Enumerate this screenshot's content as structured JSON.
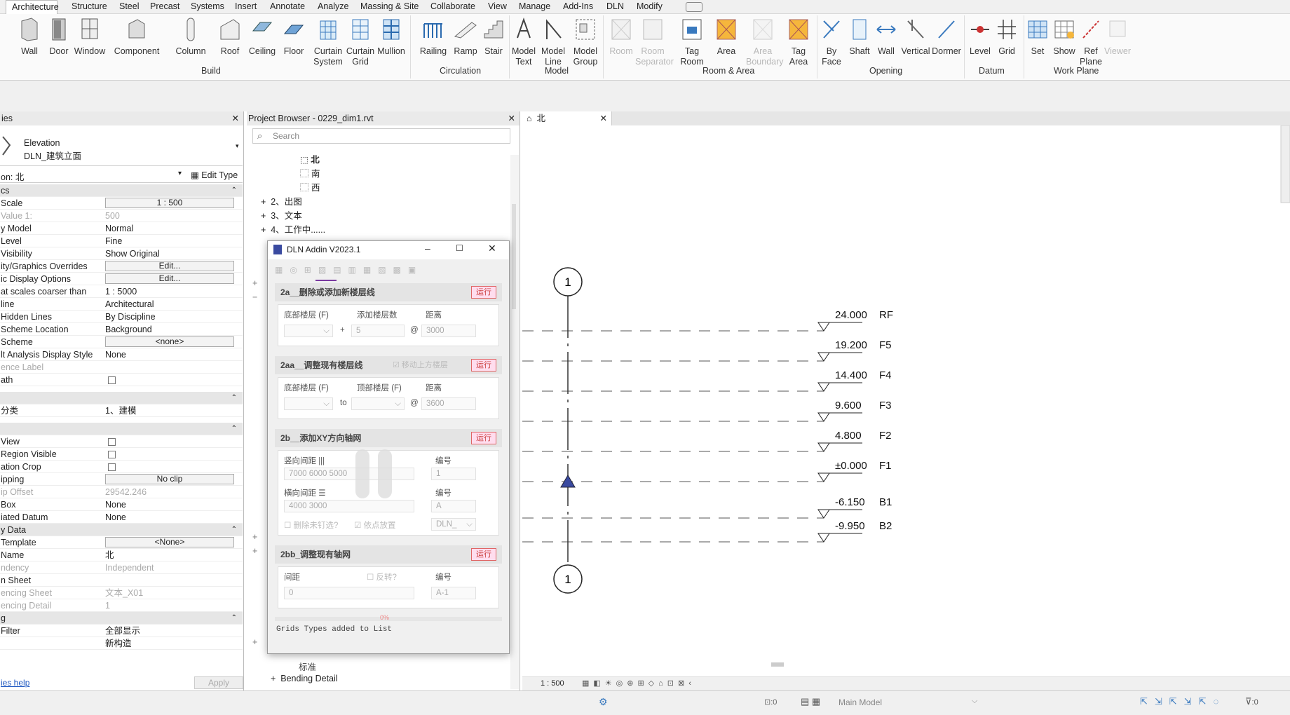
{
  "tabs": [
    "Architecture",
    "Structure",
    "Steel",
    "Precast",
    "Systems",
    "Insert",
    "Annotate",
    "Analyze",
    "Massing & Site",
    "Collaborate",
    "View",
    "Manage",
    "Add-Ins",
    "DLN",
    "Modify"
  ],
  "ribbon": {
    "build": {
      "label": "Build",
      "buttons": [
        "Wall",
        "Door",
        "Window",
        "Component",
        "Column",
        "Roof",
        "Ceiling",
        "Floor",
        "Curtain\nSystem",
        "Curtain\nGrid",
        "Mullion"
      ]
    },
    "circulation": {
      "label": "Circulation",
      "buttons": [
        "Railing",
        "Ramp",
        "Stair"
      ]
    },
    "model": {
      "label": "Model",
      "buttons": [
        "Model\nText",
        "Model\nLine",
        "Model\nGroup"
      ]
    },
    "room_area": {
      "label": "Room & Area",
      "buttons": [
        "Room",
        "Room\nSeparator",
        "Tag\nRoom",
        "Area",
        "Area\nBoundary",
        "Tag\nArea"
      ]
    },
    "opening": {
      "label": "Opening",
      "buttons": [
        "By\nFace",
        "Shaft",
        "Wall",
        "Vertical",
        "Dormer"
      ]
    },
    "datum": {
      "label": "Datum",
      "buttons": [
        "Level",
        "Grid"
      ]
    },
    "work_plane": {
      "label": "Work Plane",
      "buttons": [
        "Set",
        "Show",
        "Ref\nPlane",
        "Viewer"
      ]
    }
  },
  "properties": {
    "title": "ies",
    "type_line1": "Elevation",
    "type_line2": "DLN_建筑立面",
    "selector": "on: 北",
    "edit_type": "Edit Type",
    "section_graphics": "cs",
    "rows": [
      {
        "k": "Scale",
        "v": "1 : 500",
        "box": true
      },
      {
        "k": "Value   1:",
        "v": "500",
        "gray": true
      },
      {
        "k": "y Model",
        "v": "Normal"
      },
      {
        "k": " Level",
        "v": "Fine"
      },
      {
        "k": "Visibility",
        "v": "Show Original"
      },
      {
        "k": "ity/Graphics Overrides",
        "v": "Edit...",
        "box": true
      },
      {
        "k": "ic Display Options",
        "v": "Edit...",
        "box": true
      },
      {
        "k": "at scales coarser than",
        "v": "1 : 5000"
      },
      {
        "k": "line",
        "v": "Architectural"
      },
      {
        "k": " Hidden Lines",
        "v": "By Discipline"
      },
      {
        "k": " Scheme Location",
        "v": "Background"
      },
      {
        "k": " Scheme",
        "v": "<none>",
        "box": true
      },
      {
        "k": "lt Analysis Display Style",
        "v": "None"
      },
      {
        "k": "ence Label",
        "v": "",
        "gray": true
      },
      {
        "k": "ath",
        "v": "",
        "cb": true
      }
    ],
    "cat_label": "分类",
    "cat_value": "1、建模",
    "rows2": [
      {
        "k": "View",
        "v": "",
        "cb": true
      },
      {
        "k": "Region Visible",
        "v": "",
        "cb": true
      },
      {
        "k": "ation Crop",
        "v": "",
        "cb": true
      },
      {
        "k": "ipping",
        "v": "No clip",
        "box": true
      },
      {
        "k": "ip Offset",
        "v": "29542.246",
        "gray": true
      },
      {
        "k": " Box",
        "v": "None"
      },
      {
        "k": "iated Datum",
        "v": "None"
      }
    ],
    "section_data": "y Data",
    "rows3": [
      {
        "k": "Template",
        "v": "<None>",
        "box": true
      },
      {
        "k": "Name",
        "v": "北"
      },
      {
        "k": "ndency",
        "v": "Independent",
        "gray": true
      },
      {
        "k": "n Sheet",
        "v": ""
      },
      {
        "k": "encing Sheet",
        "v": "文本_X01",
        "gray": true
      },
      {
        "k": "encing Detail",
        "v": "1",
        "gray": true
      }
    ],
    "section_g": "g",
    "rows4": [
      {
        "k": " Filter",
        "v": "全部显示"
      },
      {
        "k": "",
        "v": "新构造"
      }
    ],
    "help": "ies help",
    "apply": "Apply"
  },
  "browser": {
    "title": "Project Browser - 0229_dim1.rvt",
    "search_placeholder": "Search",
    "items": [
      "北",
      "南",
      "西",
      "2、出图",
      "3、文本",
      "4、工作中......"
    ],
    "bottom_items": [
      "标准",
      "Bending Detail"
    ]
  },
  "view": {
    "tab": "北",
    "scale": "1 : 500",
    "levels": [
      {
        "elev": "24.000",
        "name": "RF"
      },
      {
        "elev": "19.200",
        "name": "F5"
      },
      {
        "elev": "14.400",
        "name": "F4"
      },
      {
        "elev": "9.600",
        "name": "F3"
      },
      {
        "elev": "4.800",
        "name": "F2"
      },
      {
        "elev": "±0.000",
        "name": "F1"
      },
      {
        "elev": "-6.150",
        "name": "B1"
      },
      {
        "elev": "-9.950",
        "name": "B2"
      }
    ],
    "grid_label": "1"
  },
  "dialog": {
    "title": "DLN Addin V2023.1",
    "run": "运行",
    "s1": {
      "title": "2a__删除或添加新楼层线",
      "l1": "底部楼层 (F)",
      "l2": "添加楼层数",
      "l3": "距离",
      "plus": "+",
      "at": "@",
      "count": "5",
      "dist": "3000"
    },
    "s2": {
      "title": "2aa__调整现有楼层线",
      "check": "移动上方楼层",
      "l1": "底部楼层 (F)",
      "l2": "顶部楼层 (F)",
      "l3": "距离",
      "to": "to",
      "at": "@",
      "dist": "3600"
    },
    "s3": {
      "title": "2b__添加XY方向轴网",
      "l1": "竖向间距 |||",
      "l2": "编号",
      "v1": "7000 6000 5000",
      "n1": "1",
      "l3": "横向间距 ☰",
      "l4": "编号",
      "v2": "4000 3000",
      "n2": "A",
      "cb1": "删除未钉选?",
      "cb2": "依点放置",
      "dd": "DLN_"
    },
    "s4": {
      "title": "2bb_调整现有轴网",
      "l1": "间距",
      "cb": "反转?",
      "l2": "编号",
      "v1": "0",
      "n1": "A-1"
    },
    "footer": "Grids Types added to List",
    "progress": "0%"
  },
  "status": {
    "scale": "1 : 500",
    "workset": "Main Model",
    "zero1": ":0",
    "zero2": ":0"
  }
}
